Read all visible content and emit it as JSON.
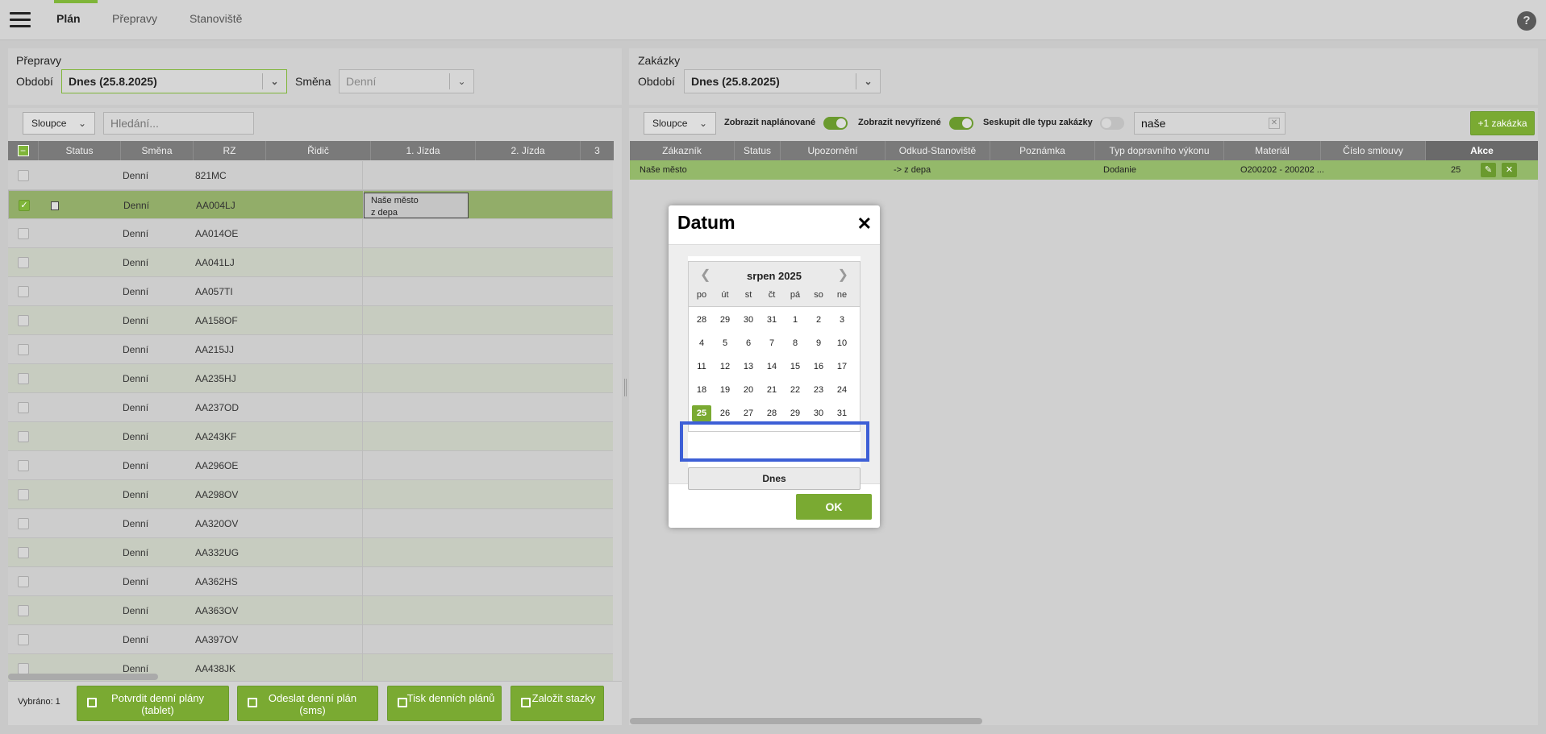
{
  "nav": {
    "tabs": [
      "Plán",
      "Přepravy",
      "Stanoviště"
    ],
    "help": "?"
  },
  "left": {
    "title": "Přepravy",
    "period_label": "Období",
    "period_value": "Dnes (25.8.2025)",
    "shift_label": "Směna",
    "shift_value": "Denní",
    "columns_button": "Sloupce",
    "search_placeholder": "Hledání...",
    "headers": [
      "Status",
      "Směna",
      "RZ",
      "Řidič",
      "1. Jízda",
      "2. Jízda"
    ],
    "rows": [
      {
        "shift": "Denní",
        "rz": "821MC"
      },
      {
        "shift": "Denní",
        "rz": "AA004LJ"
      },
      {
        "shift": "Denní",
        "rz": "AA014OE"
      },
      {
        "shift": "Denní",
        "rz": "AA041LJ"
      },
      {
        "shift": "Denní",
        "rz": "AA057TI"
      },
      {
        "shift": "Denní",
        "rz": "AA158OF"
      },
      {
        "shift": "Denní",
        "rz": "AA215JJ"
      },
      {
        "shift": "Denní",
        "rz": "AA235HJ"
      },
      {
        "shift": "Denní",
        "rz": "AA237OD"
      },
      {
        "shift": "Denní",
        "rz": "AA243KF"
      },
      {
        "shift": "Denní",
        "rz": "AA296OE"
      },
      {
        "shift": "Denní",
        "rz": "AA298OV"
      },
      {
        "shift": "Denní",
        "rz": "AA320OV"
      },
      {
        "shift": "Denní",
        "rz": "AA332UG"
      },
      {
        "shift": "Denní",
        "rz": "AA362HS"
      },
      {
        "shift": "Denní",
        "rz": "AA363OV"
      },
      {
        "shift": "Denní",
        "rz": "AA397OV"
      },
      {
        "shift": "Denní",
        "rz": "AA438JK"
      }
    ],
    "cell_line1": "Naše město",
    "cell_line2": "z depa",
    "selected_count": "Vybráno: 1",
    "buttons": [
      "Potvrdit denní plány (tablet)",
      "Odeslat denní plán (sms)",
      "Tisk denních plánů",
      "Založit stazky"
    ]
  },
  "right": {
    "title": "Zakázky",
    "period_label": "Období",
    "period_value": "Dnes (25.8.2025)",
    "columns_button": "Sloupce",
    "toggle1": "Zobrazit naplánované",
    "toggle2": "Zobrazit nevyřízené",
    "toggle3": "Seskupit dle typu zakázky",
    "search_value": "naše",
    "add_button": "+1 zakázka",
    "headers": [
      "Zákazník",
      "Status",
      "Upozornění",
      "Odkud-Stanoviště",
      "Poznámka",
      "Typ dopravního výkonu",
      "Materiál",
      "Číslo smlouvy",
      "Akce"
    ],
    "row": {
      "customer": "Naše město",
      "from": "-> z depa",
      "type": "Dodanie",
      "material": "O200202 - 200202 ...",
      "contract": "25"
    }
  },
  "modal": {
    "title": "Datum",
    "close": "✕",
    "month": "srpen 2025",
    "dow": [
      "po",
      "út",
      "st",
      "čt",
      "pá",
      "so",
      "ne"
    ],
    "weeks": [
      [
        "28",
        "29",
        "30",
        "31",
        "1",
        "2",
        "3"
      ],
      [
        "4",
        "5",
        "6",
        "7",
        "8",
        "9",
        "10"
      ],
      [
        "11",
        "12",
        "13",
        "14",
        "15",
        "16",
        "17"
      ],
      [
        "18",
        "19",
        "20",
        "21",
        "22",
        "23",
        "24"
      ],
      [
        "25",
        "26",
        "27",
        "28",
        "29",
        "30",
        "31"
      ]
    ],
    "today_button": "Dnes",
    "ok": "OK"
  }
}
